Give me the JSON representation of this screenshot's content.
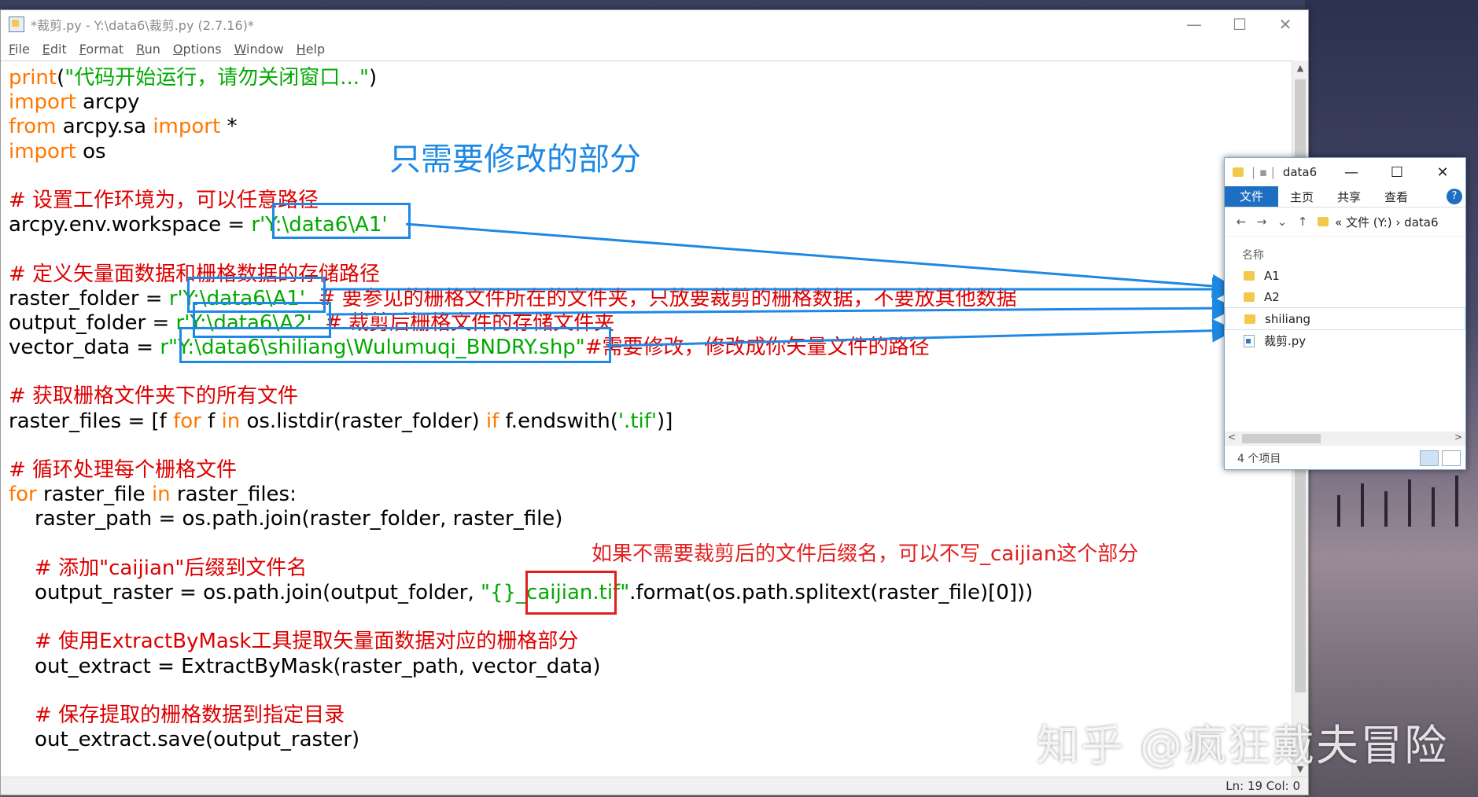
{
  "idle": {
    "title": "*裁剪.py - Y:\\data6\\裁剪.py (2.7.16)*",
    "window_buttons": [
      "—",
      "☐",
      "✕"
    ],
    "menu": [
      "File",
      "Edit",
      "Format",
      "Run",
      "Options",
      "Window",
      "Help"
    ],
    "status": "Ln: 19   Col: 0"
  },
  "code_lines": [
    [
      {
        "t": "print",
        "c": "kw"
      },
      {
        "t": "(",
        "c": ""
      },
      {
        "t": "\"代码开始运行，请勿关闭窗口...\"",
        "c": "st"
      },
      {
        "t": ")",
        "c": ""
      }
    ],
    [
      {
        "t": "import",
        "c": "kw"
      },
      {
        "t": " arcpy",
        "c": ""
      }
    ],
    [
      {
        "t": "from",
        "c": "kw"
      },
      {
        "t": " arcpy.sa ",
        "c": ""
      },
      {
        "t": "import",
        "c": "kw"
      },
      {
        "t": " *",
        "c": ""
      }
    ],
    [
      {
        "t": "import",
        "c": "kw"
      },
      {
        "t": " os",
        "c": ""
      }
    ],
    [],
    [
      {
        "t": "# 设置工作环境为，可以任意路径",
        "c": "cm"
      }
    ],
    [
      {
        "t": "arcpy.env.workspace = ",
        "c": ""
      },
      {
        "t": "r'Y:\\data6\\A1'",
        "c": "st"
      }
    ],
    [],
    [
      {
        "t": "# 定义矢量面数据和栅格数据的存储路径",
        "c": "cm"
      }
    ],
    [
      {
        "t": "raster_folder = ",
        "c": ""
      },
      {
        "t": "r'Y:\\data6\\A1'",
        "c": "st"
      },
      {
        "t": "  # 要参见的栅格文件所在的文件夹，只放要裁剪的栅格数据，不要放其他数据",
        "c": "cm"
      }
    ],
    [
      {
        "t": "output_folder = ",
        "c": ""
      },
      {
        "t": "r'Y:\\data6\\A2'",
        "c": "st"
      },
      {
        "t": "  # 裁剪后栅格文件的存储文件夹",
        "c": "cm"
      }
    ],
    [
      {
        "t": "vector_data = ",
        "c": ""
      },
      {
        "t": "r\"Y:\\data6\\shiliang\\Wulumuqi_BNDRY.shp\"",
        "c": "st"
      },
      {
        "t": "#需要修改，修改成你矢量文件的路径",
        "c": "cm"
      }
    ],
    [],
    [
      {
        "t": "# 获取栅格文件夹下的所有文件",
        "c": "cm"
      }
    ],
    [
      {
        "t": "raster_files = [f ",
        "c": ""
      },
      {
        "t": "for",
        "c": "kw"
      },
      {
        "t": " f ",
        "c": ""
      },
      {
        "t": "in",
        "c": "kw"
      },
      {
        "t": " os.listdir(raster_folder) ",
        "c": ""
      },
      {
        "t": "if",
        "c": "kw"
      },
      {
        "t": " f.endswith(",
        "c": ""
      },
      {
        "t": "'.tif'",
        "c": "st"
      },
      {
        "t": ")]",
        "c": ""
      }
    ],
    [],
    [
      {
        "t": "# 循环处理每个栅格文件",
        "c": "cm"
      }
    ],
    [
      {
        "t": "for",
        "c": "kw"
      },
      {
        "t": " raster_file ",
        "c": ""
      },
      {
        "t": "in",
        "c": "kw"
      },
      {
        "t": " raster_files:",
        "c": ""
      }
    ],
    [
      {
        "t": "    raster_path = os.path.join(raster_folder, raster_file)",
        "c": ""
      }
    ],
    [],
    [
      {
        "t": "    # 添加\"caijian\"后缀到文件名",
        "c": "cm"
      }
    ],
    [
      {
        "t": "    output_raster = os.path.join(output_folder, ",
        "c": ""
      },
      {
        "t": "\"{}_caijian.tif\"",
        "c": "st"
      },
      {
        "t": ".format(os.path.splitext(raster_file)[0]))",
        "c": ""
      }
    ],
    [],
    [
      {
        "t": "    # 使用ExtractByMask工具提取矢量面数据对应的栅格部分",
        "c": "cm"
      }
    ],
    [
      {
        "t": "    out_extract = ExtractByMask(raster_path, vector_data)",
        "c": ""
      }
    ],
    [],
    [
      {
        "t": "    # 保存提取的栅格数据到指定目录",
        "c": "cm"
      }
    ],
    [
      {
        "t": "    out_extract.save(output_raster)",
        "c": ""
      }
    ]
  ],
  "annotations": {
    "title": "只需要修改的部分",
    "red_note": "如果不需要裁剪后的文件后缀名，可以不写_caijian这个部分"
  },
  "explorer": {
    "title": "data6",
    "sep": "| ▪ |",
    "window_buttons": [
      "—",
      "☐",
      "✕"
    ],
    "ribbon": [
      "文件",
      "主页",
      "共享",
      "查看"
    ],
    "help": "?",
    "nav": [
      "←",
      "→",
      "⌄",
      "↑"
    ],
    "path": "« 文件 (Y:) › data6",
    "column": "名称",
    "items": [
      {
        "name": "A1",
        "type": "folder"
      },
      {
        "name": "A2",
        "type": "folder"
      },
      {
        "name": "shiliang",
        "type": "folder"
      },
      {
        "name": "裁剪.py",
        "type": "py"
      }
    ],
    "count": "4 个项目"
  },
  "watermark": "知乎 @疯狂戴夫冒险",
  "colors": {
    "accent_blue": "#1e88e5",
    "annot_red": "#e02020",
    "keyword": "#ff7700",
    "string": "#00aa00",
    "comment": "#dd0000"
  }
}
